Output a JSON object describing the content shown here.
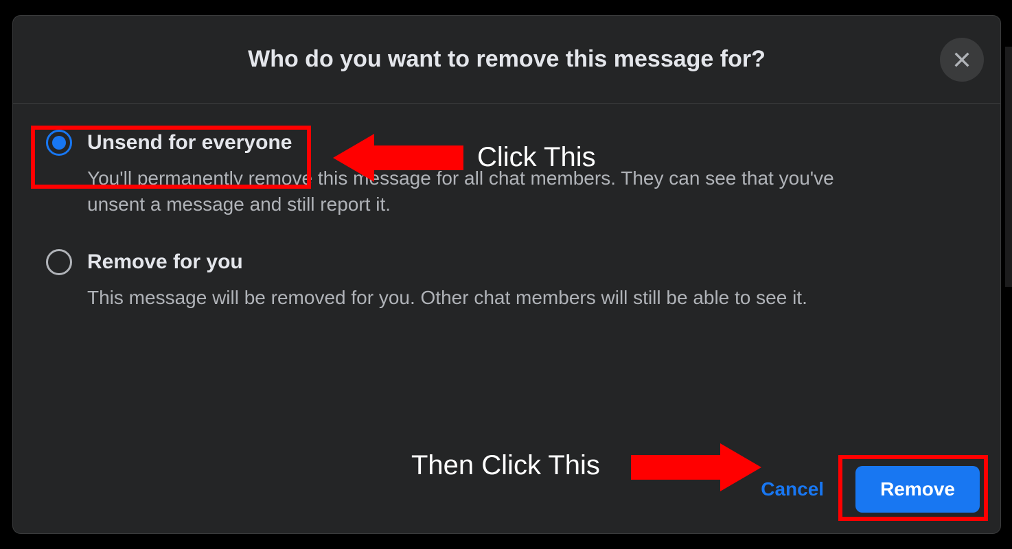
{
  "modal": {
    "title": "Who do you want to remove this message for?",
    "options": [
      {
        "label": "Unsend for everyone",
        "description": "You'll permanently remove this message for all chat members. They can see that you've unsent a message and still report it.",
        "selected": true
      },
      {
        "label": "Remove for you",
        "description": "This message will be removed for you. Other chat members will still be able to see it.",
        "selected": false
      }
    ],
    "footer": {
      "cancel_label": "Cancel",
      "remove_label": "Remove"
    }
  },
  "annotations": {
    "text_1": "Click This",
    "text_2": "Then Click This"
  },
  "colors": {
    "accent": "#1877f2",
    "highlight": "#ff0000"
  }
}
